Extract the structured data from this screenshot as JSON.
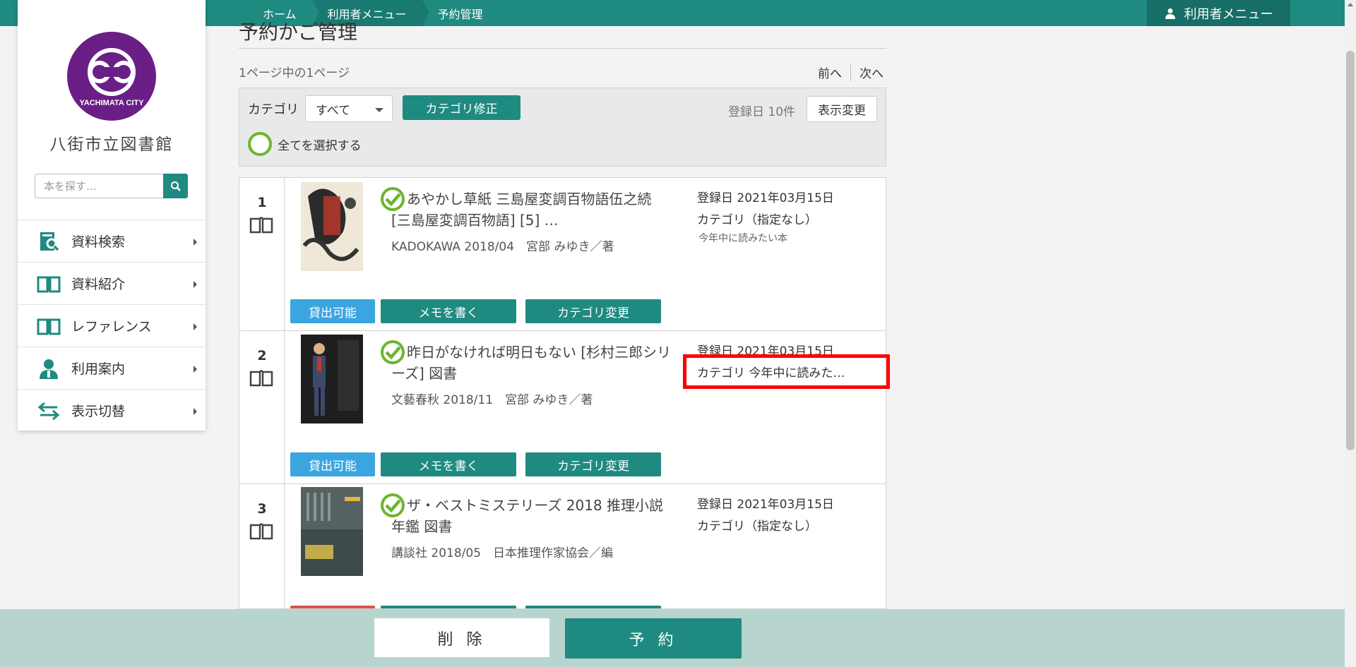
{
  "breadcrumb": [
    {
      "label": "ホーム"
    },
    {
      "label": "利用者メニュー"
    },
    {
      "label": "予約管理"
    }
  ],
  "header": {
    "user_menu_label": "利用者メニュー"
  },
  "sidebar": {
    "library_name": "八街市立図書館",
    "logo_text": "YACHIMATA CITY",
    "search_placeholder": "本を探す…",
    "items": [
      {
        "label": "資料検索",
        "icon": "catalog-search-icon"
      },
      {
        "label": "資料紹介",
        "icon": "open-book-icon"
      },
      {
        "label": "レファレンス",
        "icon": "open-book-icon"
      },
      {
        "label": "利用案内",
        "icon": "person-icon"
      },
      {
        "label": "表示切替",
        "icon": "swap-arrows-icon"
      }
    ]
  },
  "main": {
    "title": "予約かご管理",
    "page_count": "1ページ中の1ページ",
    "pager": {
      "prev": "前へ",
      "next": "次へ"
    },
    "filter": {
      "category_label": "カテゴリ",
      "category_value": "すべて",
      "category_fix_button": "カテゴリ修正",
      "sort_label": "登録日 10件",
      "display_button": "表示変更",
      "select_all_label": "全てを選択する"
    },
    "items": [
      {
        "num": "1",
        "title": "あやかし草紙 三島屋変調百物語伍之続 [三島屋変調百物語] [5] …",
        "publisher": "KADOKAWA 2018/04　宮部 みゆき／著",
        "registered": "登録日 2021年03月15日",
        "category": "カテゴリ（指定なし）",
        "memo": "今年中に読みたい本",
        "status": "貸出可能",
        "memo_button": "メモを書く",
        "category_button": "カテゴリ変更"
      },
      {
        "num": "2",
        "title": "昨日がなければ明日もない [杉村三郎シリーズ] 図書",
        "publisher": "文藝春秋 2018/11　宮部 みゆき／著",
        "registered": "登録日 2021年03月15日",
        "category": "カテゴリ 今年中に読みた…",
        "memo": "",
        "status": "貸出可能",
        "memo_button": "メモを書く",
        "category_button": "カテゴリ変更"
      },
      {
        "num": "3",
        "title": "ザ・ベストミステリーズ 2018 推理小説年鑑 図書",
        "publisher": "講談社 2018/05　日本推理作家協会／編",
        "registered": "登録日 2021年03月15日",
        "category": "カテゴリ（指定なし）",
        "memo": "",
        "status": "",
        "memo_button": "",
        "category_button": ""
      }
    ]
  },
  "bottom": {
    "delete_button": "削 除",
    "reserve_button": "予 約"
  },
  "colors": {
    "primary": "#1f8a80",
    "available": "#3ba5e0",
    "check": "#6bb52f",
    "highlight": "#ff0000"
  }
}
